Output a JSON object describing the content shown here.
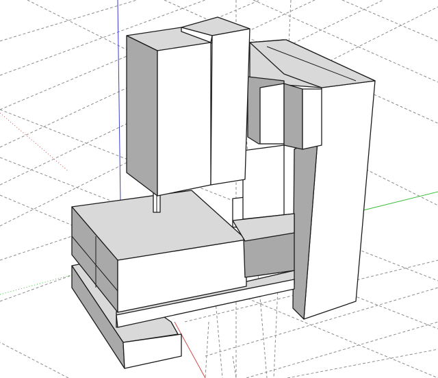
{
  "viewport": {
    "background": "#ffffff",
    "axes": {
      "red": "#d24a4a",
      "green": "#3cbf3c",
      "blue": "#3a3ad0"
    },
    "shading": {
      "light": "#ffffff",
      "mid": "#d9d9d9",
      "dark": "#a9a9a9"
    },
    "model": {
      "parts": [
        "column",
        "spindle-head",
        "motor-block",
        "spindle",
        "table-saddle",
        "base-rail"
      ]
    }
  }
}
